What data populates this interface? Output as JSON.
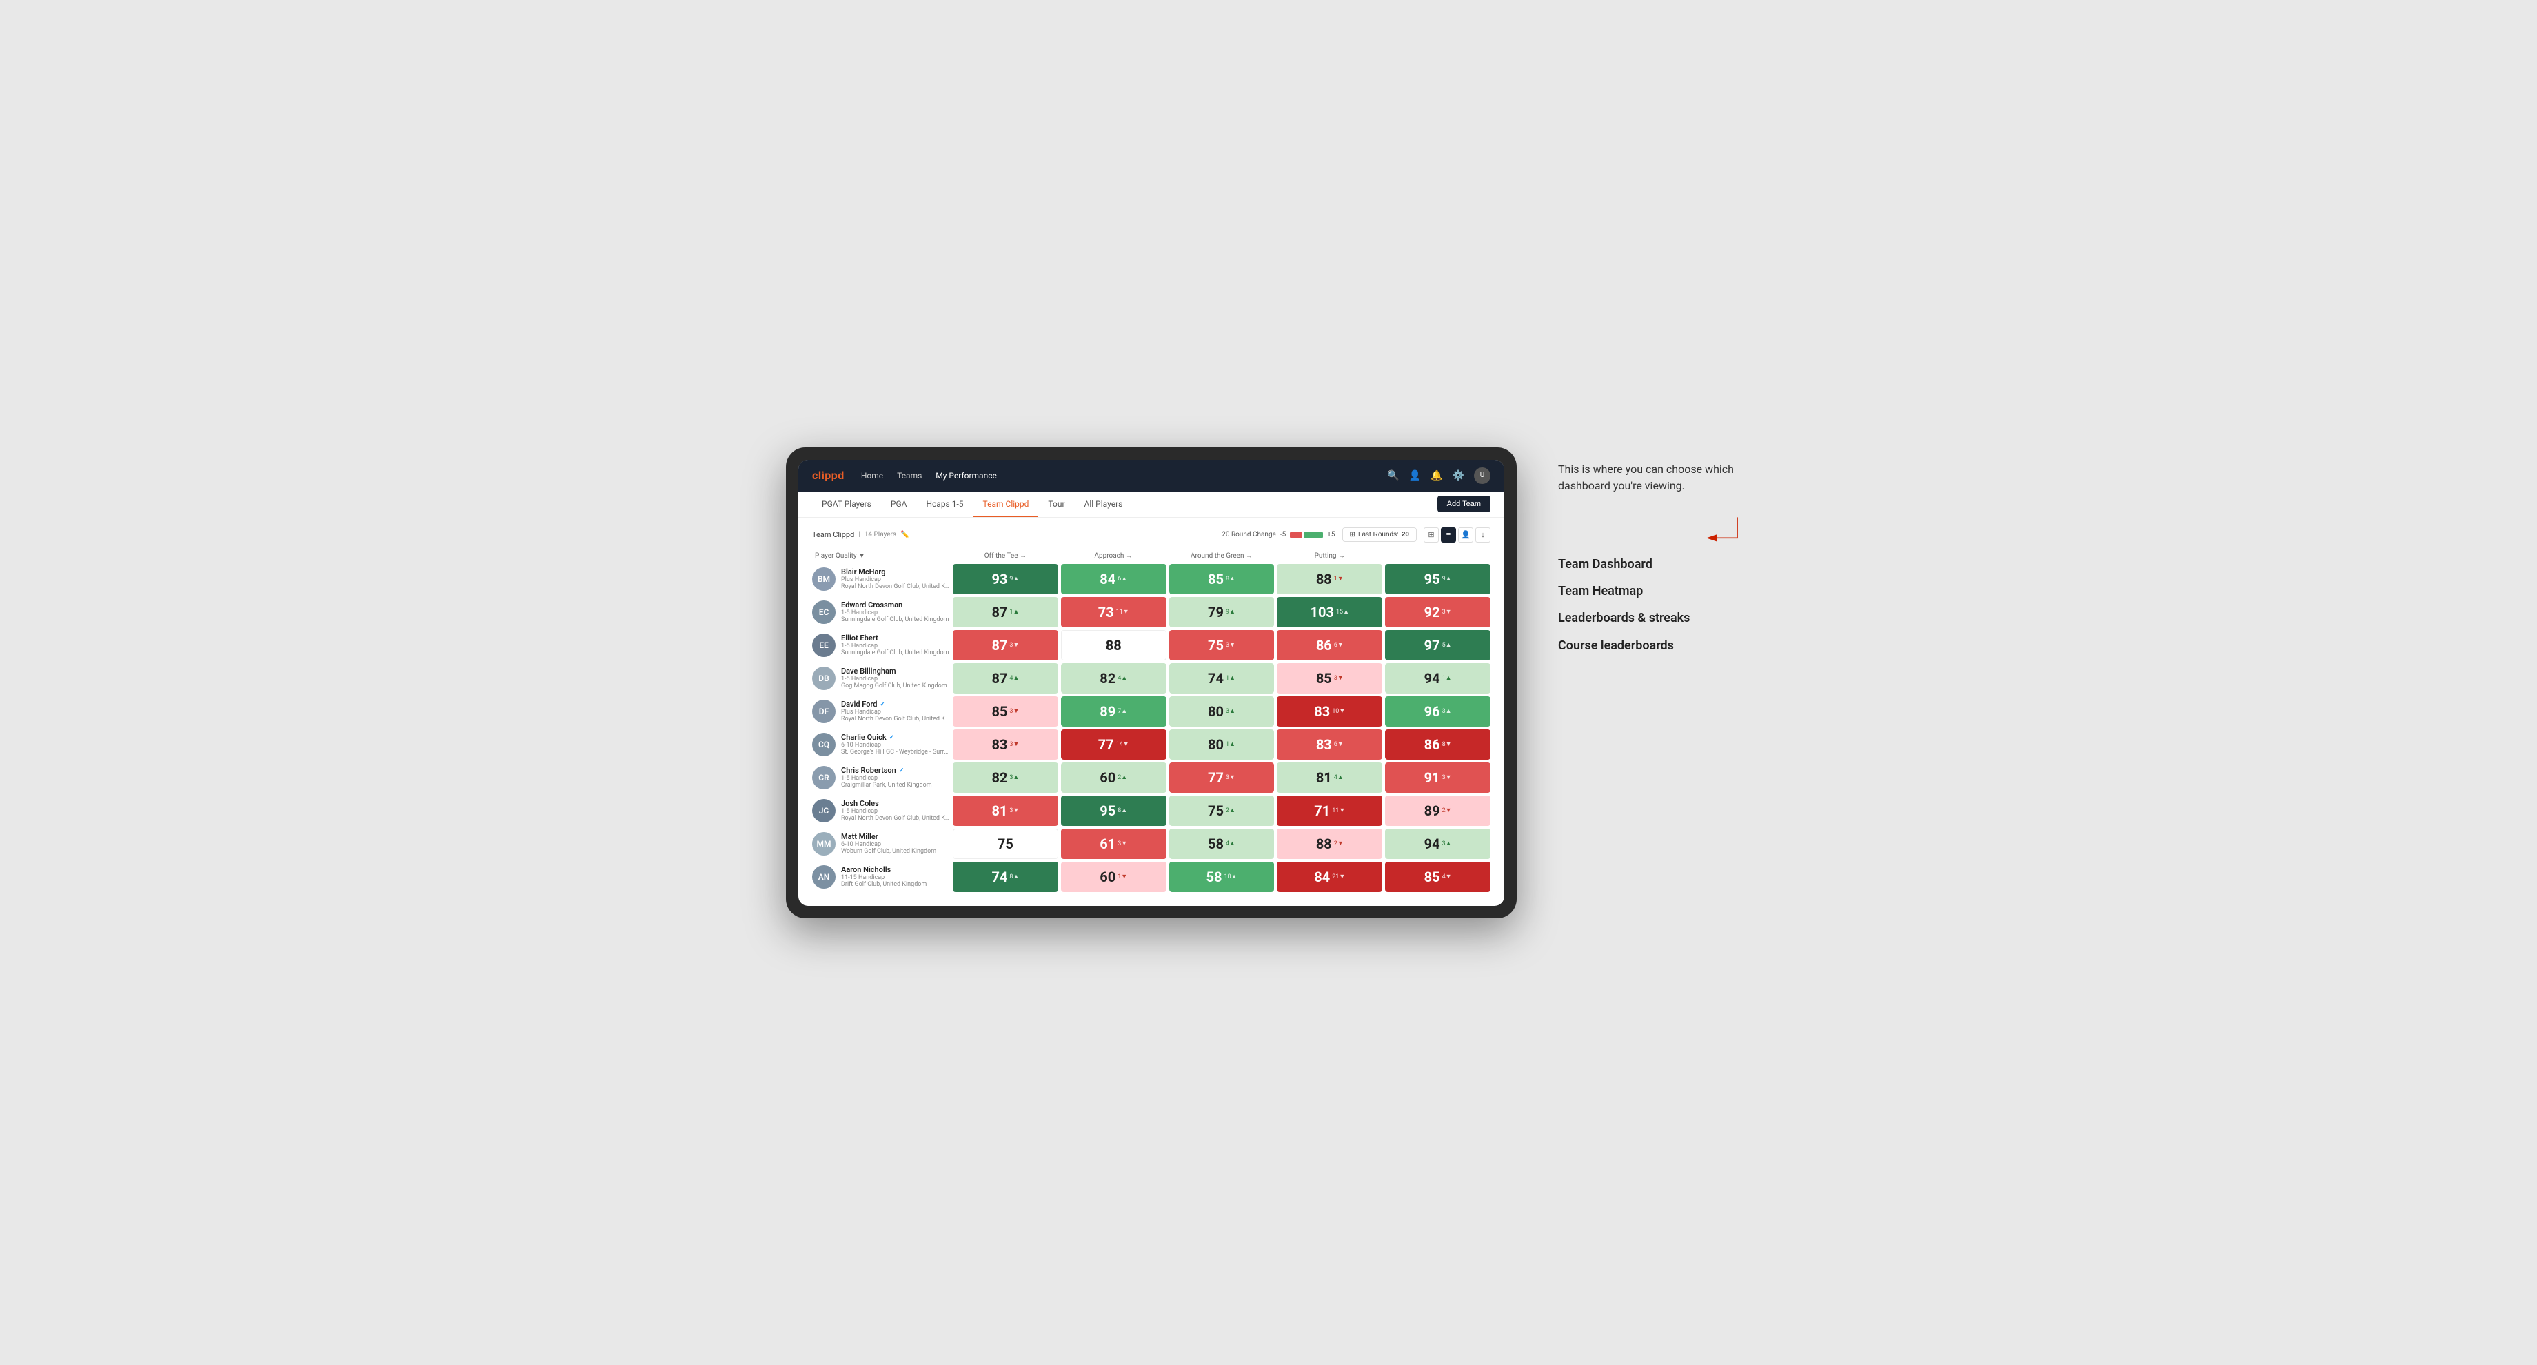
{
  "annotation": {
    "intro_text": "This is where you can choose which dashboard you're viewing.",
    "items": [
      {
        "label": "Team Dashboard"
      },
      {
        "label": "Team Heatmap"
      },
      {
        "label": "Leaderboards & streaks"
      },
      {
        "label": "Course leaderboards"
      }
    ]
  },
  "nav": {
    "logo": "clippd",
    "links": [
      "Home",
      "Teams",
      "My Performance"
    ],
    "active_link": "My Performance"
  },
  "sub_nav": {
    "links": [
      "PGAT Players",
      "PGA",
      "Hcaps 1-5",
      "Team Clippd",
      "Tour",
      "All Players"
    ],
    "active_link": "Team Clippd",
    "add_team_label": "Add Team"
  },
  "table_controls": {
    "team_label": "Team Clippd",
    "player_count": "14 Players",
    "round_change_label": "20 Round Change",
    "change_minus": "-5",
    "change_plus": "+5",
    "last_rounds_label": "Last Rounds:",
    "last_rounds_value": "20"
  },
  "col_headers": {
    "player": "Player Quality ▼",
    "tee": "Off the Tee →",
    "approach": "Approach →",
    "around_green": "Around the Green →",
    "putting": "Putting →"
  },
  "players": [
    {
      "name": "Blair McHarg",
      "handicap": "Plus Handicap",
      "club": "Royal North Devon Golf Club, United Kingdom",
      "initials": "BM",
      "avatar_color": "#8a9bb0",
      "scores": {
        "quality": {
          "value": 93,
          "change": 9,
          "dir": "up",
          "cell": "cell-dark-green"
        },
        "tee": {
          "value": 84,
          "change": 6,
          "dir": "up",
          "cell": "cell-green"
        },
        "approach": {
          "value": 85,
          "change": 8,
          "dir": "up",
          "cell": "cell-green"
        },
        "around": {
          "value": 88,
          "change": 1,
          "dir": "down",
          "cell": "cell-light-green"
        },
        "putting": {
          "value": 95,
          "change": 9,
          "dir": "up",
          "cell": "cell-dark-green"
        }
      }
    },
    {
      "name": "Edward Crossman",
      "handicap": "1-5 Handicap",
      "club": "Sunningdale Golf Club, United Kingdom",
      "initials": "EC",
      "avatar_color": "#7a8fa0",
      "scores": {
        "quality": {
          "value": 87,
          "change": 1,
          "dir": "up",
          "cell": "cell-light-green"
        },
        "tee": {
          "value": 73,
          "change": 11,
          "dir": "down",
          "cell": "cell-red"
        },
        "approach": {
          "value": 79,
          "change": 9,
          "dir": "up",
          "cell": "cell-light-green"
        },
        "around": {
          "value": 103,
          "change": 15,
          "dir": "up",
          "cell": "cell-dark-green"
        },
        "putting": {
          "value": 92,
          "change": 3,
          "dir": "down",
          "cell": "cell-red"
        }
      }
    },
    {
      "name": "Elliot Ebert",
      "handicap": "1-5 Handicap",
      "club": "Sunningdale Golf Club, United Kingdom",
      "initials": "EE",
      "avatar_color": "#6b7c8f",
      "scores": {
        "quality": {
          "value": 87,
          "change": 3,
          "dir": "down",
          "cell": "cell-red"
        },
        "tee": {
          "value": 88,
          "change": null,
          "dir": null,
          "cell": "cell-white"
        },
        "approach": {
          "value": 75,
          "change": 3,
          "dir": "down",
          "cell": "cell-red"
        },
        "around": {
          "value": 86,
          "change": 6,
          "dir": "down",
          "cell": "cell-red"
        },
        "putting": {
          "value": 97,
          "change": 5,
          "dir": "up",
          "cell": "cell-dark-green"
        }
      }
    },
    {
      "name": "Dave Billingham",
      "handicap": "1-5 Handicap",
      "club": "Gog Magog Golf Club, United Kingdom",
      "initials": "DB",
      "avatar_color": "#9aabb8",
      "scores": {
        "quality": {
          "value": 87,
          "change": 4,
          "dir": "up",
          "cell": "cell-light-green"
        },
        "tee": {
          "value": 82,
          "change": 4,
          "dir": "up",
          "cell": "cell-light-green"
        },
        "approach": {
          "value": 74,
          "change": 1,
          "dir": "up",
          "cell": "cell-light-green"
        },
        "around": {
          "value": 85,
          "change": 3,
          "dir": "down",
          "cell": "cell-light-red"
        },
        "putting": {
          "value": 94,
          "change": 1,
          "dir": "up",
          "cell": "cell-light-green"
        }
      }
    },
    {
      "name": "David Ford",
      "handicap": "Plus Handicap",
      "club": "Royal North Devon Golf Club, United Kingdom",
      "initials": "DF",
      "avatar_color": "#8596a8",
      "verified": true,
      "scores": {
        "quality": {
          "value": 85,
          "change": 3,
          "dir": "down",
          "cell": "cell-light-red"
        },
        "tee": {
          "value": 89,
          "change": 7,
          "dir": "up",
          "cell": "cell-green"
        },
        "approach": {
          "value": 80,
          "change": 3,
          "dir": "up",
          "cell": "cell-light-green"
        },
        "around": {
          "value": 83,
          "change": 10,
          "dir": "down",
          "cell": "cell-dark-red"
        },
        "putting": {
          "value": 96,
          "change": 3,
          "dir": "up",
          "cell": "cell-green"
        }
      }
    },
    {
      "name": "Charlie Quick",
      "handicap": "6-10 Handicap",
      "club": "St. George's Hill GC - Weybridge - Surrey, Uni...",
      "initials": "CQ",
      "avatar_color": "#7b8fa0",
      "verified": true,
      "scores": {
        "quality": {
          "value": 83,
          "change": 3,
          "dir": "down",
          "cell": "cell-light-red"
        },
        "tee": {
          "value": 77,
          "change": 14,
          "dir": "down",
          "cell": "cell-dark-red"
        },
        "approach": {
          "value": 80,
          "change": 1,
          "dir": "up",
          "cell": "cell-light-green"
        },
        "around": {
          "value": 83,
          "change": 6,
          "dir": "down",
          "cell": "cell-red"
        },
        "putting": {
          "value": 86,
          "change": 8,
          "dir": "down",
          "cell": "cell-dark-red"
        }
      }
    },
    {
      "name": "Chris Robertson",
      "handicap": "1-5 Handicap",
      "club": "Craigmillar Park, United Kingdom",
      "initials": "CR",
      "avatar_color": "#8a9cae",
      "verified": true,
      "scores": {
        "quality": {
          "value": 82,
          "change": 3,
          "dir": "up",
          "cell": "cell-light-green"
        },
        "tee": {
          "value": 60,
          "change": 2,
          "dir": "up",
          "cell": "cell-light-green"
        },
        "approach": {
          "value": 77,
          "change": 3,
          "dir": "down",
          "cell": "cell-red"
        },
        "around": {
          "value": 81,
          "change": 4,
          "dir": "up",
          "cell": "cell-light-green"
        },
        "putting": {
          "value": 91,
          "change": 3,
          "dir": "down",
          "cell": "cell-red"
        }
      }
    },
    {
      "name": "Josh Coles",
      "handicap": "1-5 Handicap",
      "club": "Royal North Devon Golf Club, United Kingdom",
      "initials": "JC",
      "avatar_color": "#6a7e92",
      "scores": {
        "quality": {
          "value": 81,
          "change": 3,
          "dir": "down",
          "cell": "cell-red"
        },
        "tee": {
          "value": 95,
          "change": 8,
          "dir": "up",
          "cell": "cell-dark-green"
        },
        "approach": {
          "value": 75,
          "change": 2,
          "dir": "up",
          "cell": "cell-light-green"
        },
        "around": {
          "value": 71,
          "change": 11,
          "dir": "down",
          "cell": "cell-dark-red"
        },
        "putting": {
          "value": 89,
          "change": 2,
          "dir": "down",
          "cell": "cell-light-red"
        }
      }
    },
    {
      "name": "Matt Miller",
      "handicap": "6-10 Handicap",
      "club": "Woburn Golf Club, United Kingdom",
      "initials": "MM",
      "avatar_color": "#9aaebb",
      "scores": {
        "quality": {
          "value": 75,
          "change": null,
          "dir": null,
          "cell": "cell-white"
        },
        "tee": {
          "value": 61,
          "change": 3,
          "dir": "down",
          "cell": "cell-red"
        },
        "approach": {
          "value": 58,
          "change": 4,
          "dir": "up",
          "cell": "cell-light-green"
        },
        "around": {
          "value": 88,
          "change": 2,
          "dir": "down",
          "cell": "cell-light-red"
        },
        "putting": {
          "value": 94,
          "change": 3,
          "dir": "up",
          "cell": "cell-light-green"
        }
      }
    },
    {
      "name": "Aaron Nicholls",
      "handicap": "11-15 Handicap",
      "club": "Drift Golf Club, United Kingdom",
      "initials": "AN",
      "avatar_color": "#7c90a2",
      "scores": {
        "quality": {
          "value": 74,
          "change": 8,
          "dir": "up",
          "cell": "cell-dark-green"
        },
        "tee": {
          "value": 60,
          "change": 1,
          "dir": "down",
          "cell": "cell-light-red"
        },
        "approach": {
          "value": 58,
          "change": 10,
          "dir": "up",
          "cell": "cell-green"
        },
        "around": {
          "value": 84,
          "change": 21,
          "dir": "down",
          "cell": "cell-dark-red"
        },
        "putting": {
          "value": 85,
          "change": 4,
          "dir": "down",
          "cell": "cell-dark-red"
        }
      }
    }
  ]
}
